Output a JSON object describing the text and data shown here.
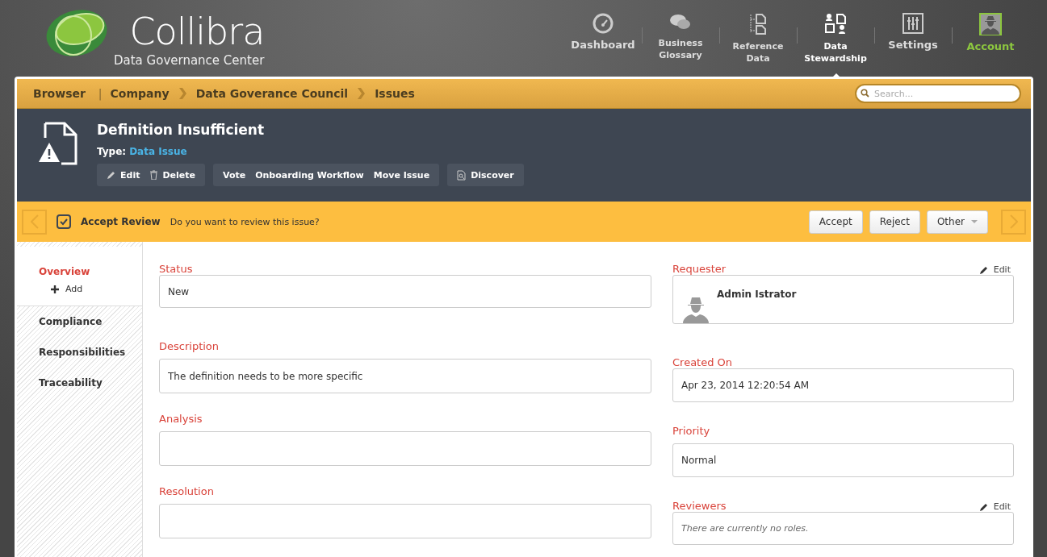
{
  "brand": {
    "name": "Collibra",
    "tagline": "Data Governance Center"
  },
  "nav": [
    {
      "label": "Dashboard",
      "kind": "module",
      "selected": false
    },
    {
      "label": "Business\nGlossary",
      "kind": "module",
      "selected": false
    },
    {
      "label": "Reference\nData",
      "kind": "module",
      "selected": false
    },
    {
      "label": "Data\nStewardship",
      "kind": "module",
      "selected": true
    },
    {
      "label": "Settings",
      "kind": "module",
      "selected": false
    },
    {
      "label": "Account",
      "kind": "account",
      "selected": false
    }
  ],
  "breadcrumb": [
    "Browser",
    "Company",
    "Data Goverance Council",
    "Issues"
  ],
  "breadcrumb_separator": "|",
  "search": {
    "placeholder": "Search..."
  },
  "asset": {
    "title": "Definition Insufficient",
    "type_label": "Type:",
    "type_value": "Data Issue",
    "action_groups": [
      [
        {
          "label": "Edit",
          "kind": "edit"
        },
        {
          "label": "Delete",
          "kind": "delete"
        }
      ],
      [
        {
          "label": "Vote",
          "kind": "plain"
        },
        {
          "label": "Onboarding Workflow",
          "kind": "plain"
        },
        {
          "label": "Move Issue",
          "kind": "plain"
        }
      ],
      [
        {
          "label": "Discover",
          "kind": "discover"
        }
      ]
    ]
  },
  "review": {
    "title": "Accept Review",
    "question": "Do you want to review this issue?",
    "buttons": [
      {
        "label": "Accept",
        "kind": "plain"
      },
      {
        "label": "Reject",
        "kind": "plain"
      },
      {
        "label": "Other",
        "kind": "dropdown"
      }
    ]
  },
  "sidebar": {
    "items": [
      {
        "label": "Overview",
        "selected": true
      },
      {
        "label": "Compliance",
        "selected": false
      },
      {
        "label": "Responsibilities",
        "selected": false
      },
      {
        "label": "Traceability",
        "selected": false
      }
    ],
    "add_label": "Add"
  },
  "left_fields": [
    {
      "label": "Status",
      "value": "New"
    },
    {
      "label": "Description",
      "value": "The definition needs to be more specific"
    },
    {
      "label": "Analysis"
    },
    {
      "label": "Resolution"
    }
  ],
  "right_fields": [
    {
      "label": "Requester",
      "kind": "person",
      "value": "Admin Istrator",
      "edit_label": "Edit"
    },
    {
      "label": "Created On",
      "kind": "text",
      "value": "Apr 23, 2014 12:20:54 AM"
    },
    {
      "label": "Priority",
      "kind": "text",
      "value": "Normal"
    },
    {
      "label": "Reviewers",
      "kind": "empty",
      "value": "There are currently no roles.",
      "edit_label": "Edit"
    }
  ]
}
